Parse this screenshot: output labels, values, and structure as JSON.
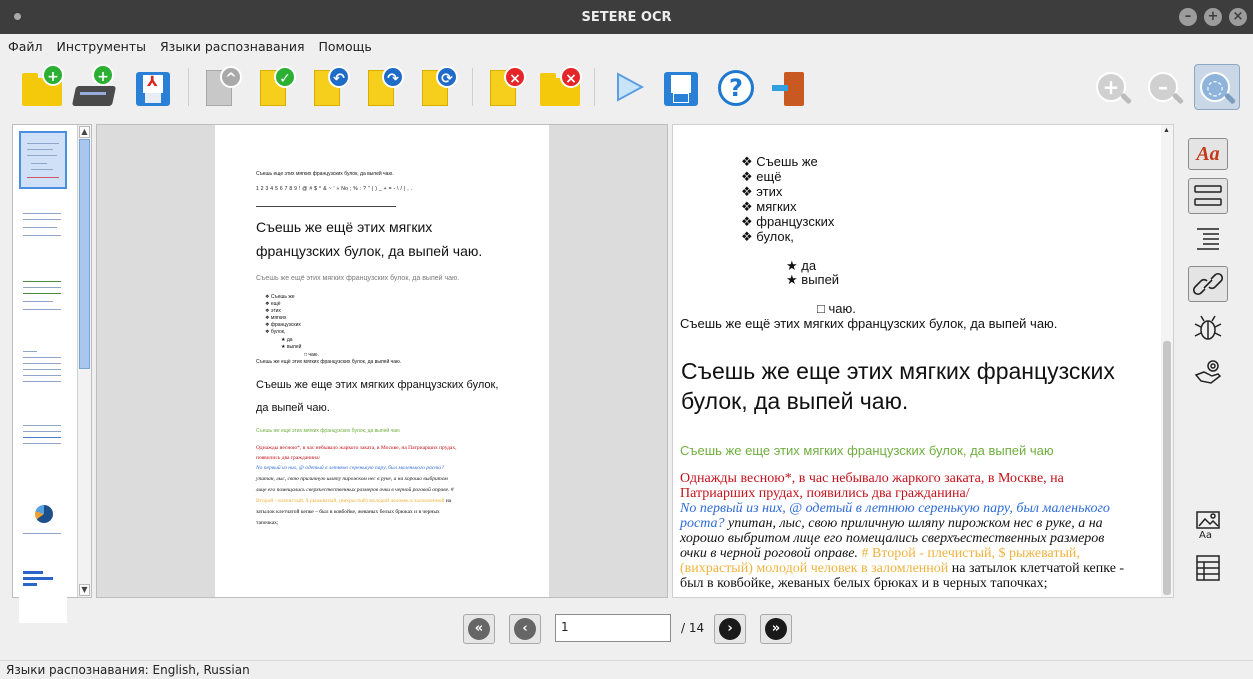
{
  "window": {
    "title": "SETERE OCR",
    "controls": [
      "–",
      "+",
      "×"
    ]
  },
  "menu": [
    "Файл",
    "Инструменты",
    "Языки распознавания",
    "Помощь"
  ],
  "toolbar": {
    "icons": [
      "open-folder-add",
      "scanner-add",
      "save-pdf",
      "page-up",
      "page-check",
      "page-rotate-left",
      "page-rotate-right",
      "page-refresh",
      "page-delete",
      "folder-delete",
      "run",
      "save",
      "help",
      "exit",
      "zoom-in",
      "zoom-out",
      "zoom-fit"
    ]
  },
  "page_image": {
    "line1": "Съешь еще этих мягких французских булок, да выпей чаю.",
    "line2": "1 2 3 4 5 6 7 8 9 ! @ # $ ^ & ~ ' » No ; % : ? \" ( ) _ + = - \\ / | , .",
    "heading1a": "Съешь же ещё этих мягких",
    "heading1b": "французских булок, да выпей чаю.",
    "grey_line": "Съешь же ещё этих мягких французских булок, да выпей чаю.",
    "bullets": [
      "Съешь же",
      "ещё",
      "этих",
      "мягких",
      "французских",
      "булок,"
    ],
    "stars": [
      "да",
      "выпей"
    ],
    "square": "чаю.",
    "small_line": "Съешь же ещё этих мягких французских булок, да выпей чаю.",
    "heading2a": "Съешь же еще этих мягких французских булок,",
    "heading2b": "да выпей чаю.",
    "green_line": "Съешь же еще этих мягких французских булок, да выпей чаю",
    "red_a": "Однажды весною*, в час небывало жаркого заката, в Москве, на Патриарших прудах,",
    "red_b": "появились два гражданина/",
    "blue_a": "No первый из них, @ одетый в летнюю серенькую пару, был маленького роста?",
    "black_a": "упитан, лыс, свою приличную шляпу пирожком нес в руке, а на хорошо выбритом",
    "black_b": "лице его помещались сверхъестественных размеров очки в черной роговой оправе. #",
    "orange_a": "Второй - плечистый, $ рыжеватый, (вихрастый) молодой человек в заломленной",
    "last_a": "на",
    "last_b": "затылок клетчатой кепке – был в ковбойке, жеваных белых брюках и в черных",
    "last_c": "тапочках;"
  },
  "text_result": {
    "bullets": [
      "Съешь же",
      "ещё",
      "этих",
      "мягких",
      "французских",
      "булок,"
    ],
    "stars": [
      "да",
      "выпей"
    ],
    "square": "чаю.",
    "line_small": "Съешь же ещё этих мягких французских булок, да выпей чаю.",
    "heading_a": "Съешь же еще этих мягких французских",
    "heading_b": "булок, да выпей чаю.",
    "green": "Съешь же еще этих мягких французских булок, да выпей чаю",
    "red_a": "Однажды весною*, в час небывало жаркого заката, в Москве, на",
    "red_b": "Патриарших прудах, появились два гражданина/",
    "blue_a": "No первый из них, @ одетый в летнюю серенькую пару, был маленького",
    "blue_b": "роста?",
    "black_b": " упитан, лыс, свою приличную шляпу пирожком нес в руке, а на",
    "black_c": "хорошо выбритом лице его помещались сверхъестественных размеров",
    "black_d": "очки в черной роговой оправе.",
    "orange_d": " # Второй - плечистый, $ рыжеватый,",
    "orange_e": "(вихрастый) молодой человек в заломленной",
    "black_e": " на затылок клетчатой кепке -",
    "black_f": "был в ковбойке, жеваных белых брюках и в черных тапочках;"
  },
  "right_tools": [
    "font-format",
    "text-block",
    "indent",
    "link",
    "bug",
    "hand-settings",
    "image-text",
    "table"
  ],
  "right_tools_label": "Aa",
  "pager": {
    "current": "1",
    "total": "/ 14",
    "first": "«",
    "prev": "‹",
    "next": "›",
    "last": "»"
  },
  "status": "Языки распознавания: English, Russian",
  "colors": {
    "green": "#6fae3f",
    "red": "#c3121b",
    "blue": "#2d6bd8",
    "orange": "#efb23c"
  }
}
